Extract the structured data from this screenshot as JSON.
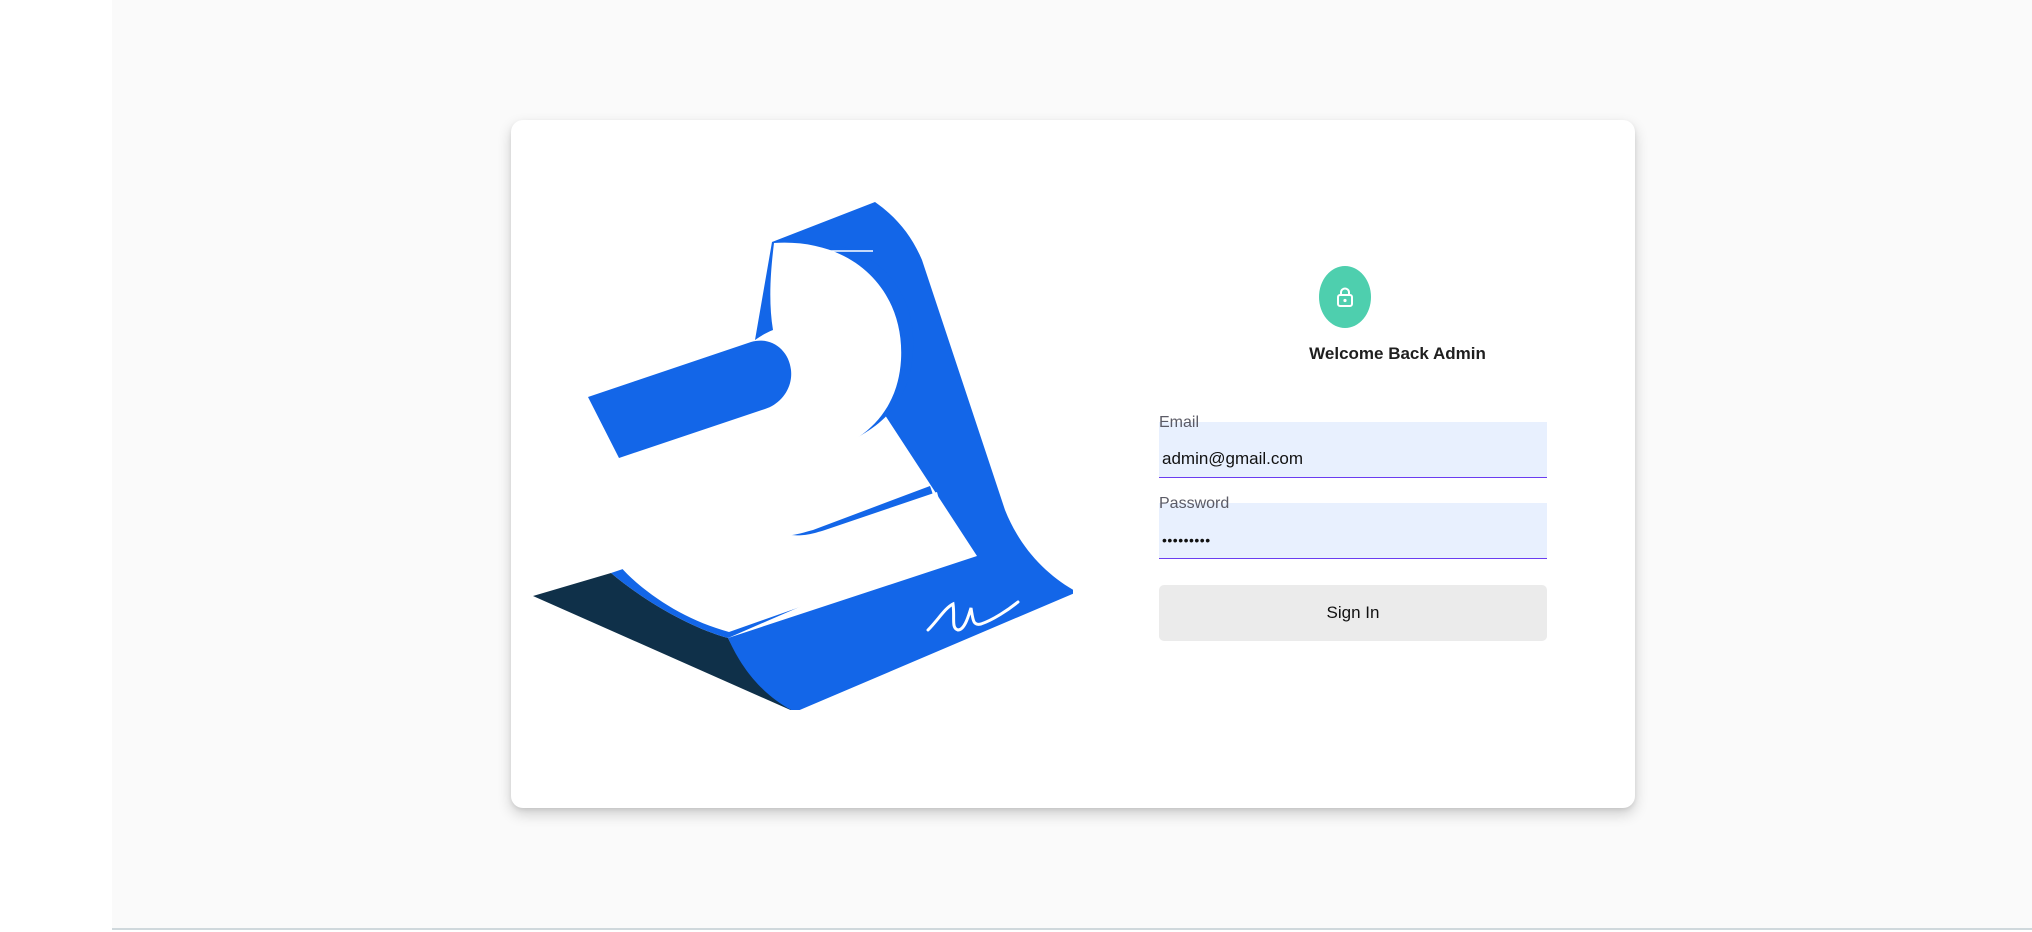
{
  "login": {
    "heading": "Welcome Back Admin",
    "email": {
      "label": "Email",
      "value": "admin@gmail.com"
    },
    "password": {
      "label": "Password",
      "value": "•••••••••"
    },
    "signin_label": "Sign In"
  },
  "icons": {
    "lock": "lock-icon",
    "logo": "brand-logo"
  },
  "colors": {
    "brand_blue": "#1366e8",
    "brand_navy": "#0f3049",
    "lock_badge": "#4ecfae",
    "input_fill": "#e8f0fe",
    "input_underline": "#6a3df0",
    "button_fill": "#ebebeb"
  }
}
